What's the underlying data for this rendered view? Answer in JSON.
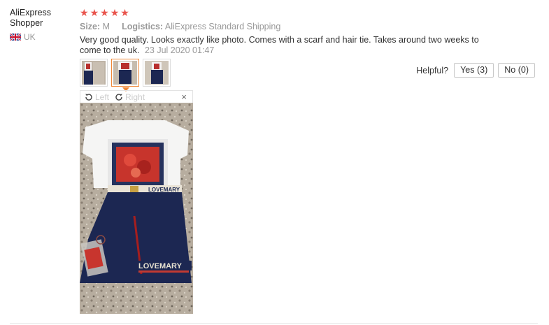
{
  "reviewer": {
    "name_line1": "AliExpress",
    "name_line2": "Shopper",
    "country": "UK",
    "flag_icon": "uk-flag-icon"
  },
  "review": {
    "rating": 5,
    "stars": [
      "★",
      "★",
      "★",
      "★",
      "★"
    ],
    "size_label": "Size:",
    "size_value": "M",
    "logistics_label": "Logistics:",
    "logistics_value": "AliExpress Standard Shipping",
    "text": "Very good quality. Looks exactly like photo. Comes with a scarf and hair tie. Takes around two weeks to come to the uk.",
    "date": "23 Jul 2020 01:47"
  },
  "thumbnails": [
    {
      "name": "thumbnail-1",
      "active": false
    },
    {
      "name": "thumbnail-2",
      "active": true
    },
    {
      "name": "thumbnail-3",
      "active": false
    }
  ],
  "viewer": {
    "rotate_left_label": "Left",
    "rotate_right_label": "Right",
    "close_glyph": "×",
    "skirt_text": "LOVEMARY",
    "belt_text": "LOVEMARY"
  },
  "helpful": {
    "label": "Helpful?",
    "yes_label": "Yes (3)",
    "no_label": "No (0)"
  },
  "colors": {
    "star": "#e9544c",
    "accent_border": "#f08838",
    "muted_text": "#999999"
  }
}
